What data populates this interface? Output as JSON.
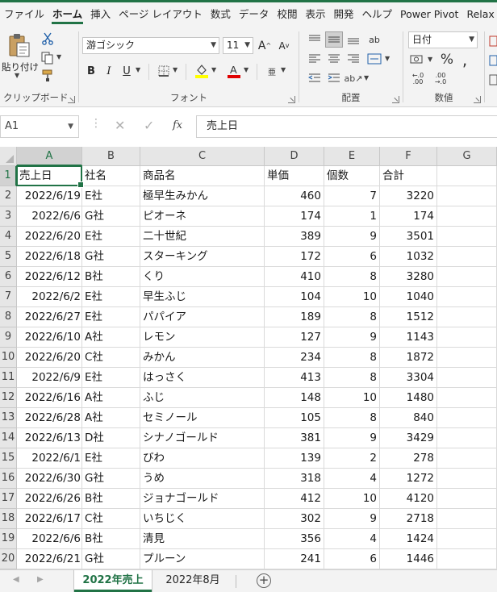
{
  "ribbon_tabs": [
    {
      "label": "ファイル",
      "active": false
    },
    {
      "label": "ホーム",
      "active": true
    },
    {
      "label": "挿入",
      "active": false
    },
    {
      "label": "ページ レイアウト",
      "active": false
    },
    {
      "label": "数式",
      "active": false
    },
    {
      "label": "データ",
      "active": false
    },
    {
      "label": "校閲",
      "active": false
    },
    {
      "label": "表示",
      "active": false
    },
    {
      "label": "開発",
      "active": false
    },
    {
      "label": "ヘルプ",
      "active": false
    },
    {
      "label": "Power Pivot",
      "active": false
    },
    {
      "label": "Relax",
      "active": false
    }
  ],
  "ribbon": {
    "clipboard": {
      "label": "クリップボード",
      "paste_label": "貼り付け"
    },
    "font": {
      "label": "フォント",
      "font_name": "游ゴシック",
      "font_size": "11"
    },
    "alignment": {
      "label": "配置"
    },
    "number": {
      "label": "数値",
      "format": "日付"
    }
  },
  "formula_bar": {
    "name_box": "A1",
    "value": "売上日"
  },
  "columns": [
    "A",
    "B",
    "C",
    "D",
    "E",
    "F",
    "G"
  ],
  "rows": [
    [
      "売上日",
      "社名",
      "商品名",
      "単価",
      "個数",
      "合計"
    ],
    [
      "2022/6/19",
      "E社",
      "極早生みかん",
      "460",
      "7",
      "3220"
    ],
    [
      "2022/6/6",
      "G社",
      "ピオーネ",
      "174",
      "1",
      "174"
    ],
    [
      "2022/6/20",
      "E社",
      "二十世紀",
      "389",
      "9",
      "3501"
    ],
    [
      "2022/6/18",
      "G社",
      "スターキング",
      "172",
      "6",
      "1032"
    ],
    [
      "2022/6/12",
      "B社",
      "くり",
      "410",
      "8",
      "3280"
    ],
    [
      "2022/6/2",
      "E社",
      "早生ふじ",
      "104",
      "10",
      "1040"
    ],
    [
      "2022/6/27",
      "E社",
      "パパイア",
      "189",
      "8",
      "1512"
    ],
    [
      "2022/6/10",
      "A社",
      "レモン",
      "127",
      "9",
      "1143"
    ],
    [
      "2022/6/20",
      "C社",
      "みかん",
      "234",
      "8",
      "1872"
    ],
    [
      "2022/6/9",
      "E社",
      "はっさく",
      "413",
      "8",
      "3304"
    ],
    [
      "2022/6/16",
      "A社",
      "ふじ",
      "148",
      "10",
      "1480"
    ],
    [
      "2022/6/28",
      "A社",
      "セミノール",
      "105",
      "8",
      "840"
    ],
    [
      "2022/6/13",
      "D社",
      "シナノゴールド",
      "381",
      "9",
      "3429"
    ],
    [
      "2022/6/1",
      "E社",
      "びわ",
      "139",
      "2",
      "278"
    ],
    [
      "2022/6/30",
      "G社",
      "うめ",
      "318",
      "4",
      "1272"
    ],
    [
      "2022/6/26",
      "B社",
      "ジョナゴールド",
      "412",
      "10",
      "4120"
    ],
    [
      "2022/6/17",
      "C社",
      "いちじく",
      "302",
      "9",
      "2718"
    ],
    [
      "2022/6/6",
      "B社",
      "清見",
      "356",
      "4",
      "1424"
    ],
    [
      "2022/6/21",
      "G社",
      "プルーン",
      "241",
      "6",
      "1446"
    ]
  ],
  "sheets": [
    {
      "name": "2022年売上",
      "active": true
    },
    {
      "name": "2022年8月",
      "active": false
    }
  ],
  "colors": {
    "accent": "#217346"
  }
}
